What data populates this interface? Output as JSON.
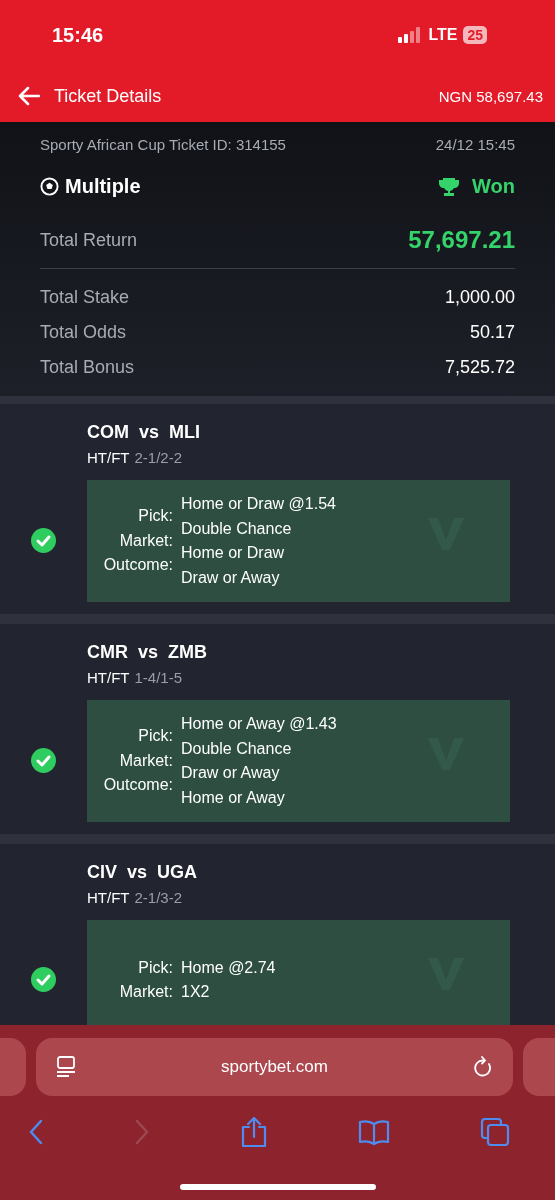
{
  "status_bar": {
    "time": "15:46",
    "network": "LTE",
    "battery": "25"
  },
  "header": {
    "title": "Ticket Details",
    "balance": "NGN 58,697.43"
  },
  "ticket": {
    "id_line": "Sporty African Cup Ticket ID: 314155",
    "datetime": "24/12 15:45",
    "type": "Multiple",
    "status": "Won",
    "total_return": {
      "label": "Total Return",
      "value": "57,697.21"
    },
    "rows": [
      {
        "label": "Total Stake",
        "value": "1,000.00"
      },
      {
        "label": "Total Odds",
        "value": "50.17"
      },
      {
        "label": "Total Bonus",
        "value": "7,525.72"
      }
    ]
  },
  "bets": [
    {
      "match": "COM vs MLI",
      "result_label": "HT/FT",
      "score": "2-1/2-2",
      "won": true,
      "labels": [
        "Pick:",
        "Market:",
        "Outcome:"
      ],
      "values": [
        "Home or Draw @1.54",
        "Double Chance",
        "Home or Draw",
        "Draw or Away"
      ]
    },
    {
      "match": "CMR vs ZMB",
      "result_label": "HT/FT",
      "score": "1-4/1-5",
      "won": true,
      "labels": [
        "Pick:",
        "Market:",
        "Outcome:"
      ],
      "values": [
        "Home or Away @1.43",
        "Double Chance",
        "Draw or Away",
        "Home or Away"
      ]
    },
    {
      "match": "CIV vs UGA",
      "result_label": "HT/FT",
      "score": "2-1/3-2",
      "won": true,
      "labels": [
        "Pick:",
        "Market:"
      ],
      "values": [
        "Home @2.74",
        "1X2"
      ]
    }
  ],
  "browser": {
    "url": "sportybet.com"
  }
}
